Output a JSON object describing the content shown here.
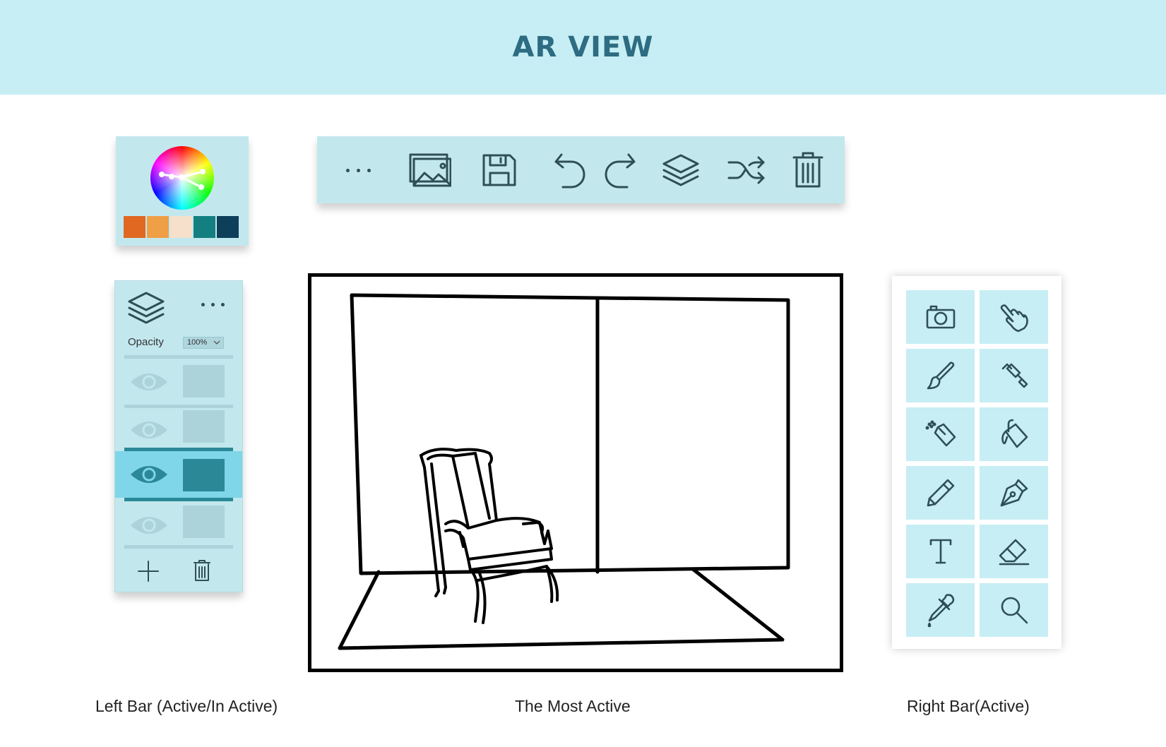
{
  "header": {
    "title": "AR VIEW"
  },
  "palette": {
    "wheel_icon": "color-wheel-icon",
    "swatches": [
      "#e06820",
      "#ef9f46",
      "#f6e0cc",
      "#137f80",
      "#0d3e5a"
    ]
  },
  "toolbar": {
    "buttons": [
      {
        "name": "more-button",
        "icon": "ellipsis-icon"
      },
      {
        "name": "image-button",
        "icon": "image-icon"
      },
      {
        "name": "save-button",
        "icon": "floppy-disk-icon"
      },
      {
        "name": "undo-button",
        "icon": "undo-icon"
      },
      {
        "name": "redo-button",
        "icon": "redo-icon"
      },
      {
        "name": "layers-button",
        "icon": "layers-icon"
      },
      {
        "name": "shuffle-button",
        "icon": "shuffle-icon"
      },
      {
        "name": "delete-button",
        "icon": "trash-icon"
      }
    ]
  },
  "layers_panel": {
    "opacity_label": "Opacity",
    "opacity_value": "100%",
    "layers": [
      {
        "visible_icon": "eye-icon",
        "active": false
      },
      {
        "visible_icon": "eye-icon",
        "active": false
      },
      {
        "visible_icon": "eye-icon",
        "active": true
      },
      {
        "visible_icon": "eye-icon",
        "active": false
      }
    ],
    "add_icon": "plus-icon",
    "delete_icon": "trash-icon"
  },
  "right_tools": [
    "camera-icon",
    "hand-pointer-icon",
    "brush-icon",
    "paint-roller-icon",
    "spray-can-icon",
    "paint-bucket-icon",
    "pencil-icon",
    "pen-nib-icon",
    "text-icon",
    "eraser-icon",
    "eyedropper-icon",
    "magnifier-icon"
  ],
  "colors": {
    "header_bg": "#c6eef4",
    "panel_bg": "#c2e8ee",
    "active_layer": "#7ed6e8",
    "active_thumb": "#2b8896",
    "title_text": "#2d6c82"
  },
  "captions": {
    "left": "Left Bar (Active/In Active)",
    "center": "The Most Active",
    "right": "Right Bar(Active)"
  }
}
